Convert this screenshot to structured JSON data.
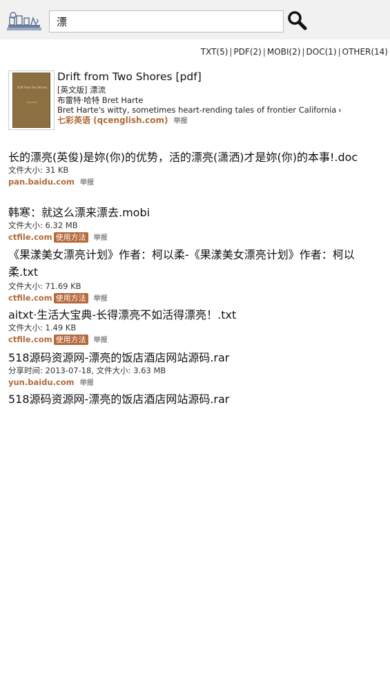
{
  "search": {
    "query": "漂"
  },
  "filters": [
    {
      "label": "TXT(5)"
    },
    {
      "label": "PDF(2)"
    },
    {
      "label": "MOBI(2)"
    },
    {
      "label": "DOC(1)"
    },
    {
      "label": "OTHER(14)"
    }
  ],
  "filter_separator": "|",
  "book": {
    "cover_title": "Drift from Two Shores",
    "cover_author": "Bret Harte",
    "title": "Drift from Two Shores [pdf]",
    "edition": "[英文版] 漂流",
    "author": "布雷特·哈特 Bret Harte",
    "description": "Bret Harte's witty, sometimes heart-rending tales of frontier California earn",
    "source": "七彩英语 (qcenglish.com)",
    "report": "举报"
  },
  "results": [
    {
      "title": "长的漂亮(英俊)是妳(你)的优势，活的漂亮(潇洒)才是妳(你)的本事!.doc",
      "meta": "文件大小: 31 KB",
      "domain": "pan.baidu.com",
      "badge": "",
      "report": "举报"
    },
    {
      "title": "韩寒：就这么漂来漂去.mobi",
      "meta": "文件大小: 6.32 MB",
      "domain": "ctfile.com",
      "badge": "使用方法",
      "report": "举报"
    },
    {
      "title": "《果漾美女漂亮计划》作者：柯以柔-《果漾美女漂亮计划》作者：柯以柔.txt",
      "meta": "文件大小: 71.69 KB",
      "domain": "ctfile.com",
      "badge": "使用方法",
      "report": "举报"
    },
    {
      "title": "aitxt·生活大宝典-长得漂亮不如活得漂亮！.txt",
      "meta": "文件大小: 1.49 KB",
      "domain": "ctfile.com",
      "badge": "使用方法",
      "report": "举报"
    },
    {
      "title": "518源码资源网-漂亮的饭店酒店网站源码.rar",
      "meta": "分享时间: 2013-07-18, 文件大小: 3.63 MB",
      "domain": "yun.baidu.com",
      "badge": "",
      "report": "举报"
    },
    {
      "title": "518源码资源网-漂亮的饭店酒店网站源码.rar"
    }
  ],
  "colors": {
    "accent": "#b06a3a",
    "badge_bg": "#b5683a",
    "header_bg": "#f1f1f1"
  }
}
